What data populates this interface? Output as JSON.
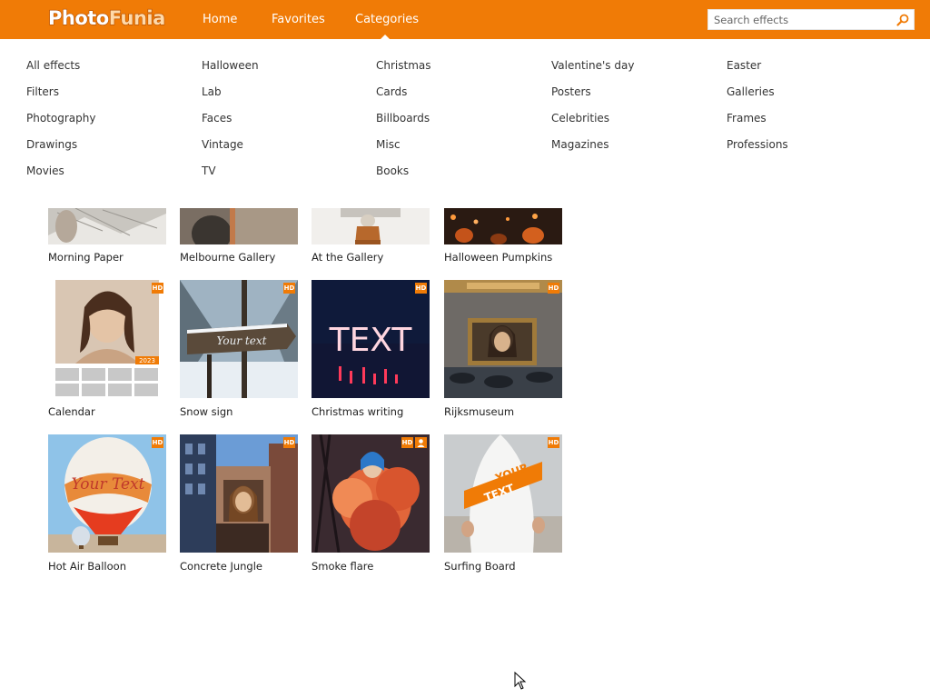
{
  "header": {
    "logo_part1": "Photo",
    "logo_part2": "Funia",
    "nav": [
      "Home",
      "Favorites",
      "Categories"
    ],
    "search_placeholder": "Search effects"
  },
  "categories": [
    [
      "All effects",
      "Filters",
      "Photography",
      "Drawings",
      "Movies"
    ],
    [
      "Halloween",
      "Lab",
      "Faces",
      "Vintage",
      "TV"
    ],
    [
      "Christmas",
      "Cards",
      "Billboards",
      "Misc",
      "Books"
    ],
    [
      "Valentine's day",
      "Posters",
      "Celebrities",
      "Magazines"
    ],
    [
      "Easter",
      "Galleries",
      "Frames",
      "Professions"
    ]
  ],
  "effects_row1": [
    "Morning Paper",
    "Melbourne Gallery",
    "At the Gallery",
    "Halloween Pumpkins"
  ],
  "effects_row2": [
    "Calendar",
    "Snow sign",
    "Christmas writing",
    "Rijksmuseum"
  ],
  "effects_row3": [
    "Hot Air Balloon",
    "Concrete Jungle",
    "Smoke flare",
    "Surfing Board"
  ],
  "badge_hd": "HD",
  "thumb_text": {
    "calendar_year": "2023",
    "snow_sign": "Your text",
    "christmas_writing": "TEXT",
    "balloon": "Your Text",
    "surf_line1": "YOUR",
    "surf_line2": "TEXT"
  },
  "colors": {
    "brand": "#f07b06"
  }
}
